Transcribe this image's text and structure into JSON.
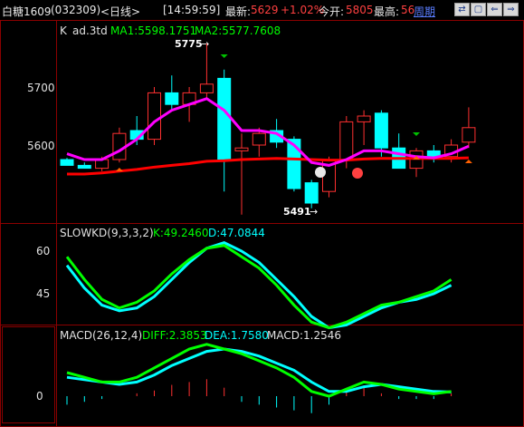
{
  "header": {
    "symbol": "白糖1609",
    "code": "(032309)",
    "period": "<日线>",
    "time": "[14:59:59]",
    "latest_label": "最新:",
    "latest_value": "5629",
    "change_pct": "+1.02%",
    "open_label": "今开:",
    "open_value": "5805",
    "high_label": "最高:",
    "high_value": "56",
    "period_link": "周期",
    "buttons": [
      "⇄",
      "▢",
      "⇐",
      "⇒"
    ]
  },
  "main_panel": {
    "label_k": "K",
    "label_ad": "ad.3td",
    "ma1_label": "MA1:5598.1751",
    "ma2_label": "MA2:5577.7608",
    "yticks": [
      "5700",
      "5600"
    ],
    "high_marker": "5775",
    "low_marker": "5491",
    "high_arrow": "→",
    "low_arrow": "→"
  },
  "kd_panel": {
    "title": "SLOWKD(9,3,3,2)",
    "k_label": "K:49.2460",
    "d_label": "D:47.0844",
    "yticks": [
      "60",
      "45"
    ]
  },
  "macd_panel": {
    "title": "MACD(26,12,4)",
    "diff_label": "DIFF:2.3853",
    "dea_label": "DEA:1.7580",
    "macd_label": "MACD:1.2546",
    "yticks": [
      "0"
    ]
  },
  "colors": {
    "up": "#ff3030",
    "down": "#00ffff",
    "ma1": "#ff00ff",
    "ma2": "#ff0000",
    "green": "#00ff00",
    "cyan": "#00ffff",
    "grid": "#8b0000"
  },
  "chart_data": {
    "type": "candlestick",
    "candles": [
      {
        "o": 5575,
        "h": 5578,
        "l": 5565,
        "c": 5565
      },
      {
        "o": 5565,
        "h": 5570,
        "l": 5560,
        "c": 5560
      },
      {
        "o": 5560,
        "h": 5580,
        "l": 5555,
        "c": 5575
      },
      {
        "o": 5575,
        "h": 5630,
        "l": 5570,
        "c": 5620
      },
      {
        "o": 5625,
        "h": 5650,
        "l": 5600,
        "c": 5610
      },
      {
        "o": 5610,
        "h": 5700,
        "l": 5600,
        "c": 5690
      },
      {
        "o": 5690,
        "h": 5720,
        "l": 5660,
        "c": 5670
      },
      {
        "o": 5670,
        "h": 5700,
        "l": 5640,
        "c": 5690
      },
      {
        "o": 5690,
        "h": 5775,
        "l": 5680,
        "c": 5705
      },
      {
        "o": 5715,
        "h": 5730,
        "l": 5520,
        "c": 5575
      },
      {
        "o": 5590,
        "h": 5620,
        "l": 5480,
        "c": 5595
      },
      {
        "o": 5600,
        "h": 5630,
        "l": 5580,
        "c": 5620
      },
      {
        "o": 5625,
        "h": 5645,
        "l": 5595,
        "c": 5605
      },
      {
        "o": 5610,
        "h": 5615,
        "l": 5520,
        "c": 5525
      },
      {
        "o": 5535,
        "h": 5540,
        "l": 5491,
        "c": 5500
      },
      {
        "o": 5520,
        "h": 5580,
        "l": 5510,
        "c": 5575
      },
      {
        "o": 5575,
        "h": 5650,
        "l": 5560,
        "c": 5640
      },
      {
        "o": 5640,
        "h": 5660,
        "l": 5600,
        "c": 5650
      },
      {
        "o": 5655,
        "h": 5660,
        "l": 5580,
        "c": 5595
      },
      {
        "o": 5595,
        "h": 5620,
        "l": 5560,
        "c": 5560
      },
      {
        "o": 5560,
        "h": 5595,
        "l": 5545,
        "c": 5590
      },
      {
        "o": 5590,
        "h": 5600,
        "l": 5570,
        "c": 5580
      },
      {
        "o": 5580,
        "h": 5610,
        "l": 5570,
        "c": 5600
      },
      {
        "o": 5605,
        "h": 5665,
        "l": 5595,
        "c": 5630
      }
    ],
    "ma1": [
      5585,
      5575,
      5575,
      5590,
      5610,
      5640,
      5660,
      5670,
      5680,
      5660,
      5625,
      5625,
      5620,
      5600,
      5570,
      5565,
      5575,
      5590,
      5590,
      5585,
      5580,
      5578,
      5585,
      5598
    ],
    "ma2": [
      5550,
      5550,
      5552,
      5555,
      5558,
      5562,
      5565,
      5568,
      5572,
      5573,
      5575,
      5576,
      5577,
      5576,
      5575,
      5574,
      5574,
      5576,
      5577,
      5577,
      5577,
      5577,
      5577,
      5578
    ],
    "kd_k": [
      58,
      50,
      43,
      40,
      42,
      46,
      52,
      57,
      61,
      62,
      58,
      54,
      48,
      41,
      35,
      33,
      35,
      38,
      41,
      42,
      44,
      46,
      50
    ],
    "kd_d": [
      55,
      47,
      41,
      39,
      40,
      44,
      50,
      56,
      61,
      63,
      60,
      56,
      50,
      44,
      37,
      33,
      34,
      37,
      40,
      42,
      43,
      45,
      48
    ],
    "macd_diff": [
      10,
      8,
      6,
      6,
      8,
      12,
      16,
      20,
      22,
      20,
      18,
      15,
      12,
      8,
      2,
      0,
      3,
      6,
      5,
      3,
      2,
      1,
      2
    ],
    "macd_dea": [
      8,
      7,
      6,
      5,
      6,
      9,
      13,
      16,
      19,
      20,
      19,
      17,
      14,
      11,
      6,
      2,
      2,
      4,
      5,
      4,
      3,
      2,
      1.8
    ],
    "macd_bars": [
      -3,
      -2,
      -1,
      0,
      1,
      2,
      4,
      5,
      6,
      3,
      -2,
      -3,
      -4,
      -5,
      -6,
      -3,
      2,
      3,
      1,
      -1,
      -1,
      -1,
      1
    ]
  }
}
